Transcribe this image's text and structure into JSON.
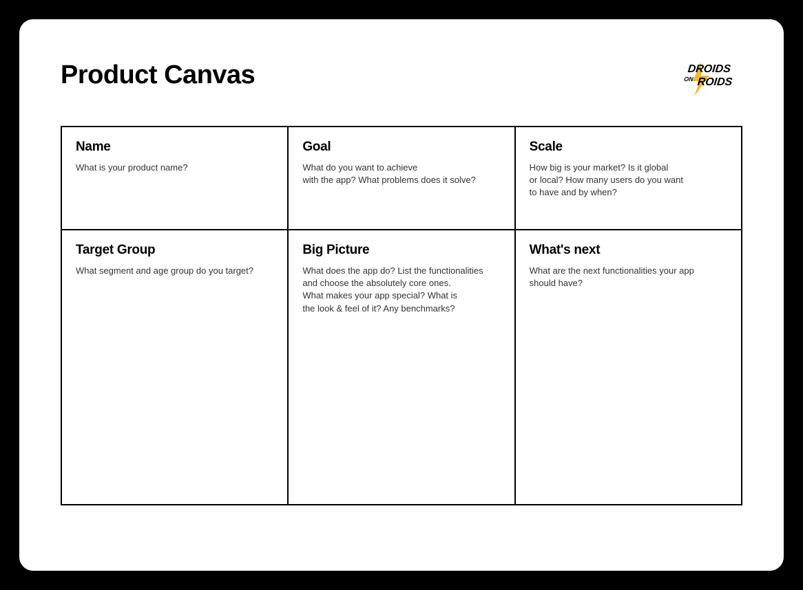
{
  "title": "Product Canvas",
  "logo": {
    "line1": "DROIDS",
    "line2": "ON",
    "line3": "ROIDS"
  },
  "cells": [
    {
      "title": "Name",
      "desc": "What is your product name?"
    },
    {
      "title": "Goal",
      "desc": "What do you want to achieve\nwith the app? What problems does it solve?"
    },
    {
      "title": "Scale",
      "desc": "How big is your market? Is it global\nor local? How many users do you want\nto have and by when?"
    },
    {
      "title": "Target Group",
      "desc": "What segment and age group do you target?"
    },
    {
      "title": "Big Picture",
      "desc": "What does the app do? List the functionalities\nand choose the absolutely core ones.\nWhat makes your app special? What is\nthe look & feel of it? Any benchmarks?"
    },
    {
      "title": "What's next",
      "desc": "What are the next functionalities your app\nshould have?"
    }
  ]
}
